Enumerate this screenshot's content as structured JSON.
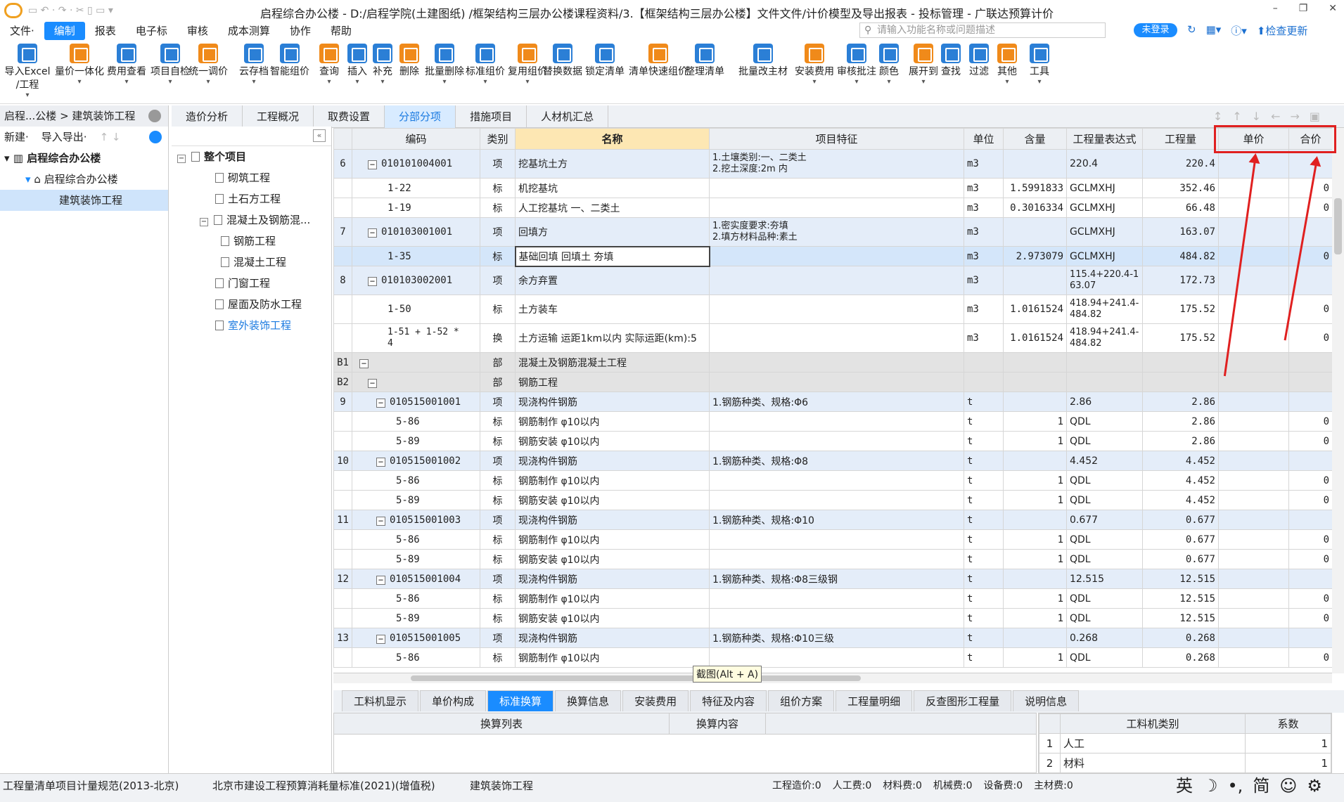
{
  "window": {
    "title": "启程综合办公楼 - D:/启程学院(土建图纸) /框架结构三层办公楼课程资料/3.【框架结构三层办公楼】文件文件/计价模型及导出报表 - 投标管理 - 广联达预算计价"
  },
  "menu": [
    "文件·",
    "编制",
    "报表",
    "电子标",
    "审核",
    "成本测算",
    "协作",
    "帮助"
  ],
  "search": {
    "placeholder": "请输入功能名称或问题描述"
  },
  "login": "未登录",
  "update": "检查更新",
  "ribbon": [
    [
      "导入Excel",
      "/工程"
    ],
    [
      "量价一体化",
      ""
    ],
    [
      "费用查看",
      ""
    ],
    [
      "项目自检",
      ""
    ],
    [
      "统一调价",
      ""
    ],
    [
      "云存档",
      ""
    ],
    [
      "智能组价",
      ""
    ],
    [
      "查询",
      ""
    ],
    [
      "插入",
      ""
    ],
    [
      "补充",
      ""
    ],
    [
      "删除",
      ""
    ],
    [
      "批量删除",
      ""
    ],
    [
      "标准组价",
      ""
    ],
    [
      "复用组价",
      ""
    ],
    [
      "替换数据",
      ""
    ],
    [
      "锁定清单",
      ""
    ],
    [
      "清单快速组价",
      ""
    ],
    [
      "整理清单",
      ""
    ],
    [
      "批量改主材",
      ""
    ],
    [
      "安装费用",
      ""
    ],
    [
      "审核批注",
      ""
    ],
    [
      "颜色",
      ""
    ],
    [
      "展开到",
      ""
    ],
    [
      "查找",
      ""
    ],
    [
      "过滤",
      ""
    ],
    [
      "其他",
      ""
    ],
    [
      "工具",
      ""
    ]
  ],
  "nav": {
    "breadcrumb": "启程...公楼 > 建筑装饰工程"
  },
  "tabs": [
    "造价分析",
    "工程概况",
    "取费设置",
    "分部分项",
    "措施项目",
    "人材机汇总"
  ],
  "left": {
    "new": "新建·",
    "import": "导入导出·",
    "root": "启程综合办公楼",
    "child": "启程综合办公楼",
    "leaf": "建筑装饰工程"
  },
  "tree": [
    {
      "label": "整个项目",
      "lvl": 0,
      "kind": "root"
    },
    {
      "label": "砌筑工程",
      "lvl": 1,
      "kind": "doc"
    },
    {
      "label": "土石方工程",
      "lvl": 1,
      "kind": "doc"
    },
    {
      "label": "混凝土及钢筋混...",
      "lvl": 1,
      "kind": "grp"
    },
    {
      "label": "钢筋工程",
      "lvl": 2,
      "kind": "doc"
    },
    {
      "label": "混凝土工程",
      "lvl": 2,
      "kind": "doc"
    },
    {
      "label": "门窗工程",
      "lvl": 1,
      "kind": "doc"
    },
    {
      "label": "屋面及防水工程",
      "lvl": 1,
      "kind": "doc"
    },
    {
      "label": "室外装饰工程",
      "lvl": 1,
      "kind": "doc-link"
    }
  ],
  "columns": [
    "",
    "编码",
    "类别",
    "名称",
    "项目特征",
    "单位",
    "含量",
    "工程量表达式",
    "工程量",
    "单价",
    "合价"
  ],
  "rows": [
    {
      "t": "qing",
      "tall": true,
      "no": "6",
      "code": "010101004001",
      "lv": 1,
      "exp": true,
      "cat": "项",
      "name": "挖基坑土方",
      "feat": "1.土壤类别:一、二类土\n2.挖土深度:2m 内",
      "unit": "m3",
      "cnt": "",
      "expr": "220.4",
      "qty": "220.4",
      "up": "",
      "tp": ""
    },
    {
      "t": "biao",
      "no": "",
      "code": "1-22",
      "lv": 2,
      "cat": "标",
      "name": "机挖基坑",
      "feat": "",
      "unit": "m3",
      "cnt": "1.5991833",
      "expr": "GCLMXHJ",
      "qty": "352.46",
      "up": "",
      "tp": "0"
    },
    {
      "t": "biao",
      "no": "",
      "code": "1-19",
      "lv": 2,
      "cat": "标",
      "name": "人工挖基坑 一、二类土",
      "feat": "",
      "unit": "m3",
      "cnt": "0.3016334",
      "expr": "GCLMXHJ",
      "qty": "66.48",
      "up": "",
      "tp": "0"
    },
    {
      "t": "qing",
      "tall": true,
      "no": "7",
      "code": "010103001001",
      "lv": 1,
      "exp": true,
      "cat": "项",
      "name": "回填方",
      "feat": "1.密实度要求:夯填\n2.填方材料品种:素土",
      "unit": "m3",
      "cnt": "",
      "expr": "GCLMXHJ",
      "qty": "163.07",
      "up": "",
      "tp": ""
    },
    {
      "t": "sel",
      "no": "",
      "code": "1-35",
      "lv": 2,
      "cat": "标",
      "name": "基础回填 回填土 夯填",
      "feat": "",
      "unit": "m3",
      "cnt": "2.973079",
      "expr": "GCLMXHJ",
      "qty": "484.82",
      "up": "",
      "tp": "0"
    },
    {
      "t": "qing",
      "tall": true,
      "no": "8",
      "code": "010103002001",
      "lv": 1,
      "exp": true,
      "cat": "项",
      "name": "余方弃置",
      "feat": "",
      "unit": "m3",
      "cnt": "",
      "expr": "115.4+220.4-1\n63.07",
      "qty": "172.73",
      "up": "",
      "tp": ""
    },
    {
      "t": "biao",
      "tall": true,
      "no": "",
      "code": "1-50",
      "lv": 2,
      "cat": "标",
      "name": "土方装车",
      "feat": "",
      "unit": "m3",
      "cnt": "1.0161524",
      "expr": "418.94+241.4-\n484.82",
      "qty": "175.52",
      "up": "",
      "tp": "0"
    },
    {
      "t": "biao",
      "tall": true,
      "no": "",
      "code": "1-51 + 1-52 *\n4",
      "lv": 2,
      "cat": "换",
      "name": "土方运输 运距1km以内  实际运距(km):5",
      "feat": "",
      "unit": "m3",
      "cnt": "1.0161524",
      "expr": "418.94+241.4-\n484.82",
      "qty": "175.52",
      "up": "",
      "tp": "0"
    },
    {
      "t": "bu",
      "no": "B1",
      "code": "",
      "lv": 0,
      "exp": true,
      "cat": "部",
      "name": "混凝土及钢筋混凝土工程",
      "feat": "",
      "unit": "",
      "cnt": "",
      "expr": "",
      "qty": "",
      "up": "",
      "tp": ""
    },
    {
      "t": "bu",
      "no": "B2",
      "code": "",
      "lv": 1,
      "exp": true,
      "cat": "部",
      "name": "钢筋工程",
      "feat": "",
      "unit": "",
      "cnt": "",
      "expr": "",
      "qty": "",
      "up": "",
      "tp": ""
    },
    {
      "t": "qing",
      "no": "9",
      "code": "010515001001",
      "lv": 2,
      "exp": true,
      "cat": "项",
      "name": "现浇构件钢筋",
      "feat": "1.钢筋种类、规格:Φ6",
      "unit": "t",
      "cnt": "",
      "expr": "2.86",
      "qty": "2.86",
      "up": "",
      "tp": ""
    },
    {
      "t": "biao",
      "no": "",
      "code": "5-86",
      "lv": 3,
      "cat": "标",
      "name": "钢筋制作 φ10以内",
      "feat": "",
      "unit": "t",
      "cnt": "1",
      "expr": "QDL",
      "qty": "2.86",
      "up": "",
      "tp": "0"
    },
    {
      "t": "biao",
      "no": "",
      "code": "5-89",
      "lv": 3,
      "cat": "标",
      "name": "钢筋安装 φ10以内",
      "feat": "",
      "unit": "t",
      "cnt": "1",
      "expr": "QDL",
      "qty": "2.86",
      "up": "",
      "tp": "0"
    },
    {
      "t": "qing",
      "no": "10",
      "code": "010515001002",
      "lv": 2,
      "exp": true,
      "cat": "项",
      "name": "现浇构件钢筋",
      "feat": "1.钢筋种类、规格:Φ8",
      "unit": "t",
      "cnt": "",
      "expr": "4.452",
      "qty": "4.452",
      "up": "",
      "tp": ""
    },
    {
      "t": "biao",
      "no": "",
      "code": "5-86",
      "lv": 3,
      "cat": "标",
      "name": "钢筋制作 φ10以内",
      "feat": "",
      "unit": "t",
      "cnt": "1",
      "expr": "QDL",
      "qty": "4.452",
      "up": "",
      "tp": "0"
    },
    {
      "t": "biao",
      "no": "",
      "code": "5-89",
      "lv": 3,
      "cat": "标",
      "name": "钢筋安装 φ10以内",
      "feat": "",
      "unit": "t",
      "cnt": "1",
      "expr": "QDL",
      "qty": "4.452",
      "up": "",
      "tp": "0"
    },
    {
      "t": "qing",
      "no": "11",
      "code": "010515001003",
      "lv": 2,
      "exp": true,
      "cat": "项",
      "name": "现浇构件钢筋",
      "feat": "1.钢筋种类、规格:Φ10",
      "unit": "t",
      "cnt": "",
      "expr": "0.677",
      "qty": "0.677",
      "up": "",
      "tp": ""
    },
    {
      "t": "biao",
      "no": "",
      "code": "5-86",
      "lv": 3,
      "cat": "标",
      "name": "钢筋制作 φ10以内",
      "feat": "",
      "unit": "t",
      "cnt": "1",
      "expr": "QDL",
      "qty": "0.677",
      "up": "",
      "tp": "0"
    },
    {
      "t": "biao",
      "no": "",
      "code": "5-89",
      "lv": 3,
      "cat": "标",
      "name": "钢筋安装 φ10以内",
      "feat": "",
      "unit": "t",
      "cnt": "1",
      "expr": "QDL",
      "qty": "0.677",
      "up": "",
      "tp": "0"
    },
    {
      "t": "qing",
      "no": "12",
      "code": "010515001004",
      "lv": 2,
      "exp": true,
      "cat": "项",
      "name": "现浇构件钢筋",
      "feat": "1.钢筋种类、规格:Φ8三级钢",
      "unit": "t",
      "cnt": "",
      "expr": "12.515",
      "qty": "12.515",
      "up": "",
      "tp": ""
    },
    {
      "t": "biao",
      "no": "",
      "code": "5-86",
      "lv": 3,
      "cat": "标",
      "name": "钢筋制作 φ10以内",
      "feat": "",
      "unit": "t",
      "cnt": "1",
      "expr": "QDL",
      "qty": "12.515",
      "up": "",
      "tp": "0"
    },
    {
      "t": "biao",
      "no": "",
      "code": "5-89",
      "lv": 3,
      "cat": "标",
      "name": "钢筋安装 φ10以内",
      "feat": "",
      "unit": "t",
      "cnt": "1",
      "expr": "QDL",
      "qty": "12.515",
      "up": "",
      "tp": "0"
    },
    {
      "t": "qing",
      "no": "13",
      "code": "010515001005",
      "lv": 2,
      "exp": true,
      "cat": "项",
      "name": "现浇构件钢筋",
      "feat": "1.钢筋种类、规格:Φ10三级",
      "unit": "t",
      "cnt": "",
      "expr": "0.268",
      "qty": "0.268",
      "up": "",
      "tp": ""
    },
    {
      "t": "biao",
      "no": "",
      "code": "5-86",
      "lv": 3,
      "cat": "标",
      "name": "钢筋制作 φ10以内",
      "feat": "",
      "unit": "t",
      "cnt": "1",
      "expr": "QDL",
      "qty": "0.268",
      "up": "",
      "tp": "0"
    }
  ],
  "tooltip": "截图(Alt + A)",
  "bottom_tabs": [
    "工料机显示",
    "单价构成",
    "标准换算",
    "换算信息",
    "安装费用",
    "特征及内容",
    "组价方案",
    "工程量明细",
    "反查图形工程量",
    "说明信息"
  ],
  "bottom_left": {
    "cols": [
      "换算列表",
      "换算内容"
    ]
  },
  "bottom_right": {
    "cols": [
      "工料机类别",
      "系数"
    ],
    "rows": [
      [
        "1",
        "人工",
        "1"
      ],
      [
        "2",
        "材料",
        "1"
      ]
    ]
  },
  "status": {
    "s1": "工程量清单项目计量规范(2013-北京)",
    "s2": "北京市建设工程预算消耗量标准(2021)(增值税)",
    "s3": "建筑装饰工程",
    "totals": [
      "工程造价:0",
      "人工费:0",
      "材料费:0",
      "机械费:0",
      "设备费:0",
      "主材费:0"
    ],
    "ime": [
      "英",
      "☽",
      "•,",
      "简",
      "☺",
      "⚙"
    ]
  },
  "colors": {
    "accent": "#1a8cff",
    "highlight": "#e02020"
  }
}
